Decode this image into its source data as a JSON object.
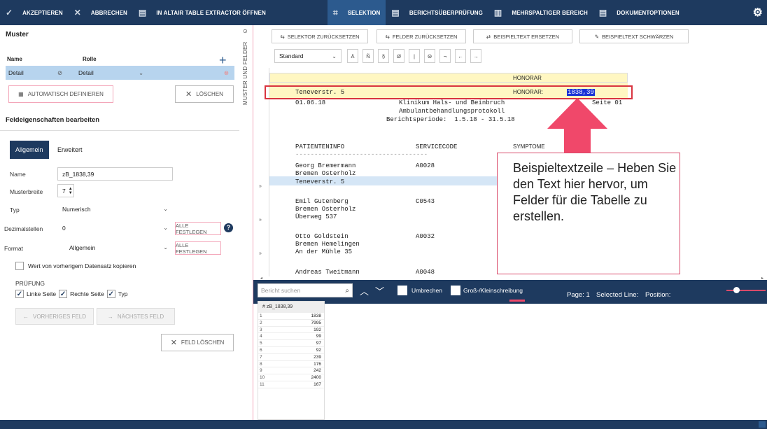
{
  "toolbar": {
    "accept": "AKZEPTIEREN",
    "cancel": "ABBRECHEN",
    "open": "IN ALTAIR TABLE EXTRACTOR ÖFFNEN",
    "selection": "SELEKTION",
    "review": "BERICHTSÜBERPRÜFUNG",
    "multicol": "MEHRSPALTIGER BEREICH",
    "docopts": "DOKUMENTOPTIONEN"
  },
  "left": {
    "title": "Muster",
    "col_name": "Name",
    "col_role": "Rolle",
    "row_name": "Detail",
    "row_role": "Detail",
    "auto_define": "AUTOMATISCH DEFINIEREN",
    "delete": "LÖSCHEN",
    "field_props": "Feldeigenschaften bearbeiten",
    "tab_general": "Allgemein",
    "tab_advanced": "Erweitert",
    "name_label": "Name",
    "name_value": "zB_1838,39",
    "width_label": "Musterbreite",
    "width_value": "7",
    "type_label": "Typ",
    "type_value": "Numerisch",
    "decimals_label": "Dezimalstellen",
    "decimals_value": "0",
    "set_all": "ALLE FESTLEGEN",
    "format_label": "Format",
    "format_value": "Allgemein",
    "copy_prev": "Wert von vorherigem Datensatz kopieren",
    "check_title": "PRÜFUNG",
    "left_page": "Linke Seite",
    "right_page": "Rechte Seite",
    "type_chk": "Typ",
    "prev_field": "VORHERIGES FELD",
    "next_field": "NÄCHSTES FELD",
    "delete_field": "FELD LÖSCHEN"
  },
  "side_tab": "MUSTER UND FELDER",
  "tools": {
    "reset_selector": "SELEKTOR ZURÜCKSETZEN",
    "reset_fields": "FELDER ZURÜCKSETZEN",
    "replace_sample": "BEISPIELTEXT ERSETZEN",
    "redact_sample": "BEISPIELTEXT SCHWÄRZEN",
    "pattern_select": "Standard",
    "chars": [
      "Ä",
      "Ñ",
      "§",
      "Ø",
      "|",
      "Θ",
      "¬",
      "←",
      "→"
    ]
  },
  "doc": {
    "honorar_header": "HONORAR",
    "sample_left": "Teneverstr. 5",
    "sample_label": "HONORAR:",
    "sample_value": "1838,39",
    "l1a": "01.06.18",
    "l1b": "Klinikum Hals- und Beinbruch",
    "l1c": "Seite 01",
    "l2": "Ambulantbehandlungsprotokoll",
    "l3": "Berichtsperiode:  1.5.18 - 31.5.18",
    "h_patient": "PATIENTENINFO",
    "h_service": "SERVICECODE",
    "h_symptom": "SYMPTOME",
    "dash": "-----------------------------------",
    "p1": "Georg Bremermann",
    "p1b": "Bremen Osterholz",
    "p1c": "Teneverstr. 5",
    "c1": "A0028",
    "p2": "Emil Gutenberg",
    "p2b": "Bremen Osterholz",
    "p2c": "Überweg 537",
    "c2": "C0543",
    "p3": "Otto Goldstein",
    "p3b": "Bremen Hemelingen",
    "p3c": "An der Mühle 35",
    "c3": "A0032",
    "p4": "Andreas Tweitmann",
    "c4": "A0048"
  },
  "callout": "Beispieltextzeile – Heben Sie den Text hier hervor, um Felder für die Tabelle zu erstellen.",
  "search": {
    "placeholder": "Bericht suchen",
    "wrap": "Umbrechen",
    "case": "Groß-/Kleinschreibung",
    "page": "Page: 1",
    "sel_line": "Selected Line:",
    "position": "Position:"
  },
  "grid": {
    "header": "# zB_1838,39",
    "rows": [
      [
        "1",
        "1838"
      ],
      [
        "2",
        "7995"
      ],
      [
        "3",
        "192"
      ],
      [
        "4",
        "99"
      ],
      [
        "5",
        "97"
      ],
      [
        "6",
        "92"
      ],
      [
        "7",
        "239"
      ],
      [
        "8",
        "176"
      ],
      [
        "9",
        "242"
      ],
      [
        "10",
        "2400"
      ],
      [
        "11",
        "167"
      ]
    ]
  }
}
